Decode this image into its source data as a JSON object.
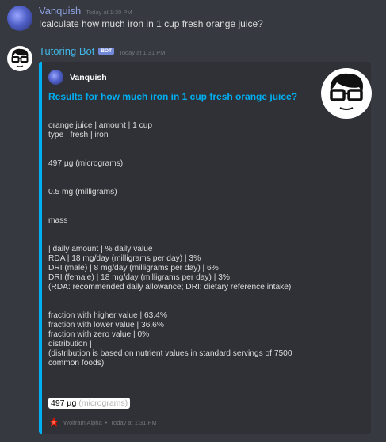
{
  "messages": [
    {
      "author": "Vanquish",
      "timestamp": "Today at 1:30 PM",
      "text": "!calculate how much iron in 1 cup fresh orange juice?"
    },
    {
      "author": "Tutoring Bot",
      "badge": "BOT",
      "timestamp": "Today at 1:31 PM",
      "embed": {
        "author": "Vanquish",
        "title": "Results for how much iron in 1 cup fresh orange juice?",
        "lines": [
          "orange juice | amount | 1 cup",
          "type | fresh | iron",
          "",
          "",
          "497 µg (micrograms)",
          "",
          "",
          "0.5 mg (milligrams)",
          "",
          "",
          "mass",
          "",
          "",
          "| daily amount | % daily value",
          "RDA | 18 mg/day (milligrams per day) | 3%",
          "DRI (male) | 8 mg/day (milligrams per day) | 6%",
          "DRI (female) | 18 mg/day (milligrams per day) | 3%",
          "(RDA: recommended daily allowance; DRI: dietary reference intake)",
          "",
          "",
          "fraction with higher value | 63.4%",
          "fraction with lower value | 36.6%",
          "fraction with zero value | 0%",
          "distribution |",
          "(distribution is based on nutrient values in standard servings of 7500",
          "common foods)"
        ],
        "result_value": "497 µg",
        "result_unit": "(micrograms)",
        "footer_source": "Wolfram Alpha",
        "footer_separator": "•",
        "footer_timestamp": "Today at 1:31 PM"
      }
    }
  ],
  "colors": {
    "background": "#36393f",
    "embed_background": "#2f3136",
    "embed_accent": "#00b0f4",
    "bot_name": "#41b6e8",
    "user_name": "#8ea1e1",
    "bot_badge": "#7289da"
  },
  "icons": {
    "user_avatar": "galaxy-avatar-icon",
    "bot_avatar": "nerd-glasses-avatar-icon",
    "footer": "wolfram-alpha-icon"
  }
}
